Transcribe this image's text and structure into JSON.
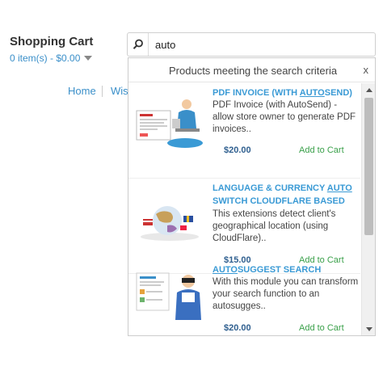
{
  "cart": {
    "title": "Shopping Cart",
    "summary": "0 item(s) - $0.00"
  },
  "nav": {
    "home": "Home",
    "wishlist_partial": "Wis"
  },
  "search": {
    "query": "auto",
    "dropdown_title": "Products meeting the search criteria",
    "close": "x"
  },
  "results": [
    {
      "title_before": "PDF INVOICE (WITH ",
      "title_match": "AUTO",
      "title_after": "SEND)",
      "description": "PDF Invoice (with AutoSend) - allow store owner to generate PDF invoices..",
      "price": "$20.00",
      "add_label": "Add to Cart",
      "image_icon": "pdf-invoice-thumbnail"
    },
    {
      "title_before": "LANGUAGE & CURRENCY ",
      "title_match": "AUTO",
      "title_after": " SWITCH CLOUDFLARE BASED",
      "description": "This extensions detect client's geographical location (using CloudFlare)..",
      "price": "$15.00",
      "add_label": "Add to Cart",
      "image_icon": "globe-flags-thumbnail"
    },
    {
      "title_before": "",
      "title_match": "AUTO",
      "title_after": "SUGGEST SEARCH",
      "description": "With this module you can transform your search function to an autosugges..",
      "price": "$20.00",
      "add_label": "Add to Cart",
      "image_icon": "binoculars-man-thumbnail"
    }
  ],
  "colors": {
    "link": "#3a8fc9",
    "title": "#3a9ad5",
    "price": "#2f5f8f",
    "add_to_cart": "#3aa04a"
  }
}
